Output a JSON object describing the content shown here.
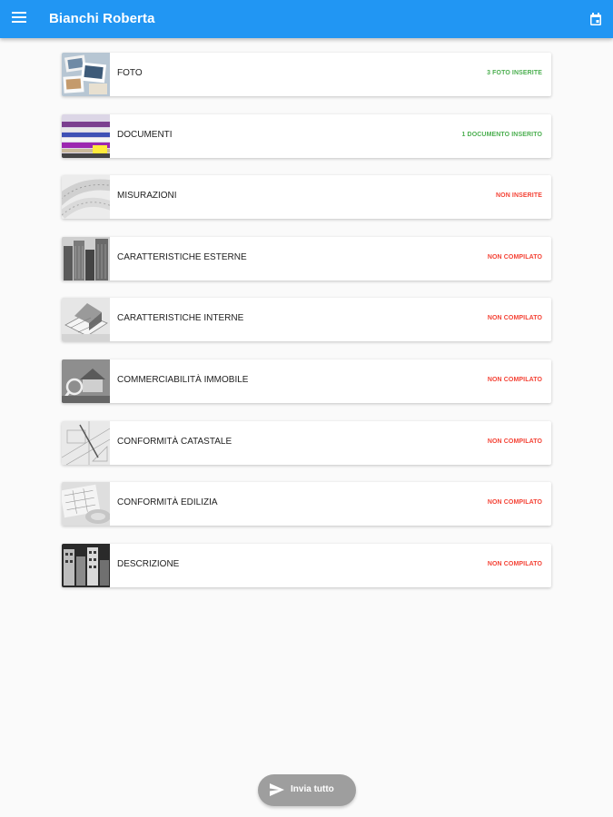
{
  "appbar": {
    "title": "Bianchi Roberta",
    "left_icon": "menu-icon",
    "right_icon": "calendar-icon",
    "color": "#2196f3"
  },
  "items": [
    {
      "label": "FOTO",
      "status": "3 FOTO INSERITE",
      "status_color": "#4caf50",
      "thumb": "photos"
    },
    {
      "label": "DOCUMENTI",
      "status": "1 DOCUMENTO INSERITO",
      "status_color": "#4caf50",
      "thumb": "documents"
    },
    {
      "label": "MISURAZIONI",
      "status": "NON INSERITE",
      "status_color": "#f44336",
      "thumb": "measuring-tape"
    },
    {
      "label": "CARATTERISTICHE ESTERNE",
      "status": "NON COMPILATO",
      "status_color": "#f44336",
      "thumb": "buildings"
    },
    {
      "label": "CARATTERISTICHE INTERNE",
      "status": "NON COMPILATO",
      "status_color": "#f44336",
      "thumb": "floor-plan-model"
    },
    {
      "label": "COMMERCIABILITÀ IMMOBILE",
      "status": "NON COMPILATO",
      "status_color": "#f44336",
      "thumb": "house-magnifier"
    },
    {
      "label": "CONFORMITÀ CATASTALE",
      "status": "NON COMPILATO",
      "status_color": "#f44336",
      "thumb": "drafting-tools"
    },
    {
      "label": "CONFORMITÀ EDILIZIA",
      "status": "NON COMPILATO",
      "status_color": "#f44336",
      "thumb": "blueprints"
    },
    {
      "label": "DESCRIZIONE",
      "status": "NON COMPILATO",
      "status_color": "#f44336",
      "thumb": "city-facades"
    }
  ],
  "fab": {
    "label": "Invia tutto",
    "icon": "send-icon",
    "color": "#9e9e9e"
  }
}
